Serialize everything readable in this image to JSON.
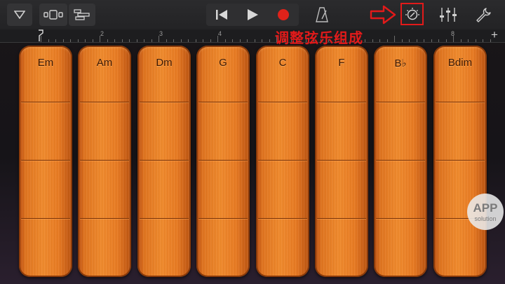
{
  "toolbar": {
    "icons": [
      "dropdown-triangle-icon",
      "view-toggle-icon",
      "tracks-view-icon",
      "rewind-icon",
      "play-icon",
      "record-icon",
      "metronome-icon",
      "chord-strips-settings-icon",
      "mixer-icon",
      "settings-wrench-icon"
    ]
  },
  "ruler": {
    "numbers": [
      "2",
      "3",
      "4",
      "8"
    ],
    "add_label": "+"
  },
  "annotation": {
    "text": "调整弦乐组成",
    "color": "#e21a1a"
  },
  "chords": [
    {
      "name": "Em"
    },
    {
      "name": "Am"
    },
    {
      "name": "Dm"
    },
    {
      "name": "G"
    },
    {
      "name": "C"
    },
    {
      "name": "F"
    },
    {
      "name": "B♭"
    },
    {
      "name": "Bdim"
    }
  ],
  "watermark": {
    "line1": "APP",
    "line2": "solution"
  },
  "colors": {
    "strip_orange": "#f08a2c",
    "record_red": "#e0221a",
    "highlight_red": "#e21a1a"
  }
}
